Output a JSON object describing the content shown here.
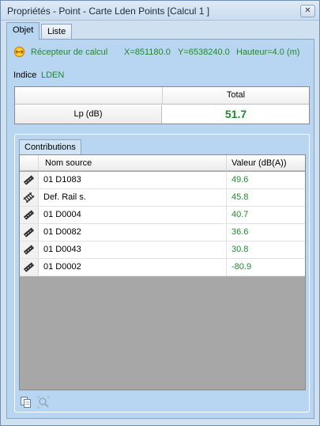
{
  "window": {
    "title": "Propriétés - Point - Carte Lden Points [Calcul 1 ]",
    "close_label": "✕"
  },
  "tabs": [
    {
      "label": "Objet",
      "active": true
    },
    {
      "label": "Liste",
      "active": false
    }
  ],
  "receiver": {
    "icon": "receiver-icon",
    "label": "Récepteur de calcul",
    "x": "X=851180.0",
    "y": "Y=6538240.0",
    "hauteur": "Hauteur=4.0 (m)"
  },
  "indice": {
    "label": "Indice",
    "value": "LDEN"
  },
  "total_table": {
    "header": "Total",
    "row_label": "Lp (dB)",
    "row_value": "51.7"
  },
  "contributions": {
    "tab_label": "Contributions",
    "columns": [
      "Nom source",
      "Valeur (dB(A))"
    ],
    "rows": [
      {
        "icon": "road-icon",
        "name": "01 D1083",
        "value": "49.6"
      },
      {
        "icon": "rail-icon",
        "name": "Def. Rail s.",
        "value": "45.8"
      },
      {
        "icon": "road-icon",
        "name": "01 D0004",
        "value": "40.7"
      },
      {
        "icon": "road-icon",
        "name": "01 D0082",
        "value": "36.6"
      },
      {
        "icon": "road-icon",
        "name": "01 D0043",
        "value": "30.8"
      },
      {
        "icon": "road-icon",
        "name": "01 D0002",
        "value": "-80.9"
      }
    ]
  },
  "toolbar": {
    "icons": [
      "copy-icon",
      "zoom-to-object-icon"
    ]
  },
  "colors": {
    "accent_green": "#1f8a2f",
    "panel_blue": "#b8d6f1",
    "grid_empty": "#a7a7a7"
  }
}
